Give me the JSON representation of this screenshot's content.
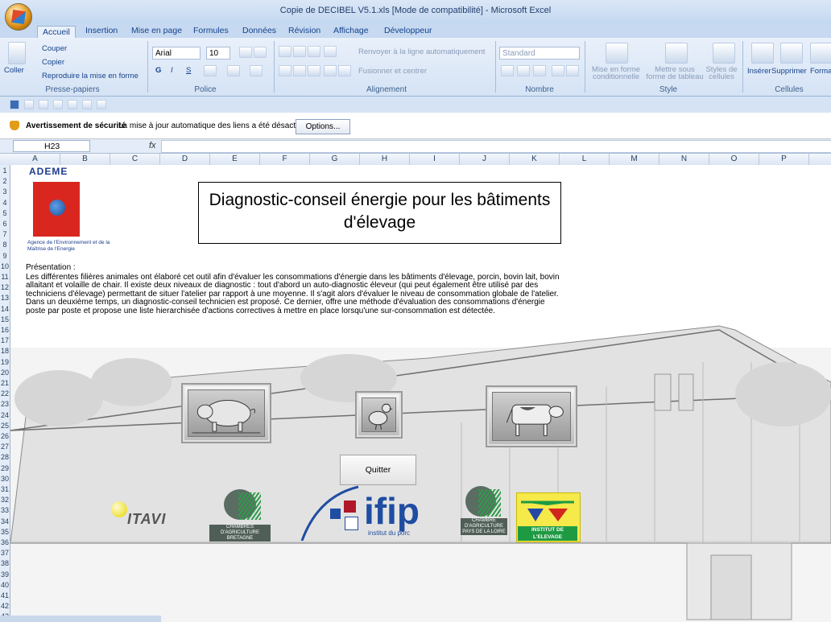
{
  "window": {
    "title": "Copie de DECIBEL V5.1.xls  [Mode de compatibilité] - Microsoft Excel"
  },
  "tabs": [
    "Accueil",
    "Insertion",
    "Mise en page",
    "Formules",
    "Données",
    "Révision",
    "Affichage",
    "Développeur"
  ],
  "ribbon": {
    "clipboard": {
      "paste": "Coller",
      "cut": "Couper",
      "copy": "Copier",
      "format_painter": "Reproduire la mise en forme",
      "label": "Presse-papiers"
    },
    "font": {
      "name": "Arial",
      "size": "10",
      "label": "Police",
      "bold": "G",
      "italic": "I",
      "underline": "S"
    },
    "alignment": {
      "wrap": "Renvoyer à la ligne automatiquement",
      "merge": "Fusionner et centrer",
      "label": "Alignement"
    },
    "number": {
      "format": "Standard",
      "label": "Nombre"
    },
    "style": {
      "conditional": "Mise en forme conditionnelle",
      "table": "Mettre sous forme de tableau",
      "cell_styles": "Styles de cellules",
      "label": "Style"
    },
    "cells": {
      "insert": "Insérer",
      "delete": "Supprimer",
      "format": "Format",
      "label": "Cellules"
    }
  },
  "security_bar": {
    "title": "Avertissement de sécurité",
    "message": "La mise à jour automatique des liens a été désactivée",
    "options": "Options..."
  },
  "formula_bar": {
    "name_box": "H23",
    "fx": "fx"
  },
  "columns": [
    "A",
    "B",
    "C",
    "D",
    "E",
    "F",
    "G",
    "H",
    "I",
    "J",
    "K",
    "L",
    "M",
    "N",
    "O",
    "P"
  ],
  "rows": [
    "1",
    "2",
    "3",
    "4",
    "5",
    "6",
    "7",
    "8",
    "9",
    "10",
    "11",
    "12",
    "13",
    "14",
    "15",
    "16",
    "17",
    "18",
    "19",
    "20",
    "21",
    "22",
    "23",
    "24",
    "25",
    "26",
    "27",
    "28",
    "29",
    "30",
    "31",
    "32",
    "33",
    "34",
    "35",
    "36",
    "37",
    "38",
    "39",
    "40",
    "41",
    "42",
    "43"
  ],
  "sheet": {
    "ademe_word": "ADEME",
    "ademe_caption": "Agence de l'Environnement et de la Maîtrise de l'Energie",
    "title": "Diagnostic-conseil énergie pour les bâtiments d'élevage",
    "presentation_label": "Présentation :",
    "presentation_text": "Les différentes filières animales ont élaboré cet outil afin d'évaluer les consommations d'énergie dans les bâtiments d'élevage, porcin, bovin lait, bovin allaitant et volaille de chair. Il existe deux niveaux de diagnostic : tout d'abord un auto-diagnostic éleveur (qui peut également être utilisé par des techniciens d'élevage) permettant de situer l'atelier par rapport à une moyenne. Il s'agit alors d'évaluer le niveau de consommation globale de l'atelier. Dans un deuxième temps, un diagnostic-conseil technicien est proposé. Ce dernier, offre une méthode d'évaluation des consommations d'énergie poste par poste et propose une liste hierarchisée d'actions correctives à mettre en place lorsqu'une sur-consommation est détectée.",
    "quit": "Quitter",
    "partners": {
      "itavi": "ITAVI",
      "chambre1": "CHAMBRES D'AGRICULTURE BRETAGNE",
      "ifip": "ifip",
      "ifip_sub": "institut du porc",
      "chambre2": "CHAMBRE D'AGRICULTURE PAYS DE LA LOIRE",
      "institut": "INSTITUT DE L'ELEVAGE"
    }
  }
}
